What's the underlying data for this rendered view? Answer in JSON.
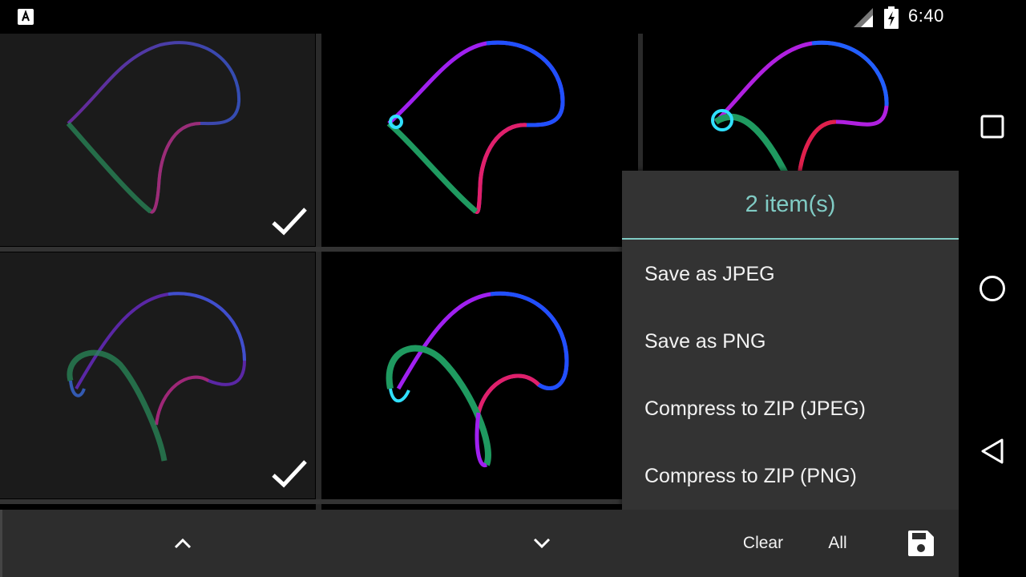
{
  "status_bar": {
    "time": "6:40",
    "icons": [
      "app-notification-icon",
      "signal-icon",
      "battery-charging-icon"
    ]
  },
  "grid": {
    "items": [
      {
        "name": "drawing-1",
        "selected": true
      },
      {
        "name": "drawing-2",
        "selected": false
      },
      {
        "name": "drawing-3",
        "selected": false
      },
      {
        "name": "drawing-4",
        "selected": true
      },
      {
        "name": "drawing-5",
        "selected": false
      }
    ]
  },
  "menu": {
    "title": "2 item(s)",
    "items": [
      {
        "label": "Save as JPEG"
      },
      {
        "label": "Save as PNG"
      },
      {
        "label": "Compress to ZIP (JPEG)"
      },
      {
        "label": "Compress to ZIP (PNG)"
      }
    ]
  },
  "toolbar": {
    "up_icon": "chevron-up-icon",
    "down_icon": "chevron-down-icon",
    "clear_label": "Clear",
    "all_label": "All",
    "save_icon": "save-icon"
  },
  "nav": {
    "icons": [
      "recents-square-icon",
      "home-circle-icon",
      "back-triangle-icon"
    ]
  },
  "colors": {
    "accent": "#80cbc4",
    "menu_bg": "#333333",
    "bottom_bar": "#2d2d2d",
    "selected_cell_bg": "#1b1b1b"
  }
}
